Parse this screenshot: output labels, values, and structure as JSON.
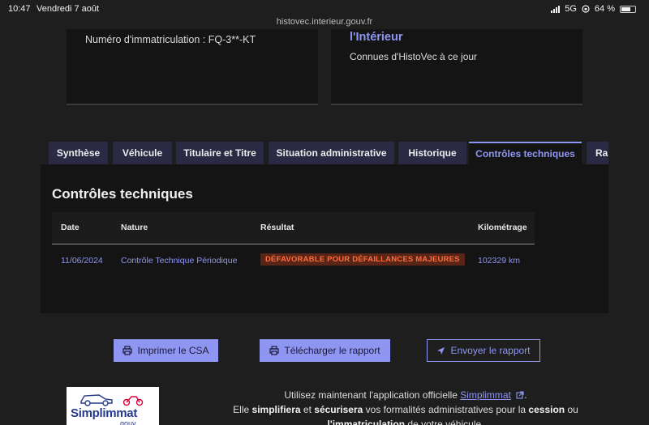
{
  "status_bar": {
    "time": "10:47",
    "date": "Vendredi 7 août",
    "network": "5G",
    "battery": "64 %",
    "battery_level": 0.64
  },
  "browser": {
    "url": "histovec.interieur.gouv.fr"
  },
  "cards": {
    "registration": "Numéro d'immatriculation : FQ-3**-KT",
    "source_title": "l'Intérieur",
    "source_subtitle": "Connues d'HistoVec à ce jour"
  },
  "tabs": [
    {
      "label": "Synthèse",
      "active": false
    },
    {
      "label": "Véhicule",
      "active": false
    },
    {
      "label": "Titulaire et Titre",
      "active": false
    },
    {
      "label": "Situation administrative",
      "active": false
    },
    {
      "label": "Historique",
      "active": false
    },
    {
      "label": "Contrôles techniques",
      "active": true
    },
    {
      "label": "Rap",
      "active": false
    }
  ],
  "panel": {
    "title": "Contrôles techniques",
    "table": {
      "headers": {
        "date": "Date",
        "nature": "Nature",
        "result": "Résultat",
        "mileage": "Kilométrage"
      },
      "rows": [
        {
          "date": "11/06/2024",
          "nature": "Contrôle Technique Périodique",
          "result": "DÉFAVORABLE POUR DÉFAILLANCES MAJEURES",
          "mileage": "102329 km"
        }
      ]
    }
  },
  "actions": {
    "print_label": "Imprimer le CSA",
    "download_label": "Télécharger le rapport",
    "send_label": "Envoyer le rapport"
  },
  "promo": {
    "logo_text": "Simplimmat",
    "logo_sub": "gouv",
    "line1_prefix": "Utilisez maintenant l'application officielle",
    "line1_link": "Simplimmat",
    "line1_suffix": ".",
    "line2_a": "Elle",
    "line2_b": "simplifiera",
    "line2_c": "et",
    "line2_d": "sécurisera",
    "line2_e": "vos formalités administratives pour la",
    "line2_f": "cession",
    "line2_g": "ou",
    "line3_a": "l'immatriculation",
    "line3_b": "de votre véhicule."
  },
  "colors": {
    "accent": "#8f96f2",
    "background": "#1e1e1e",
    "panel": "#141414",
    "tab_inactive": "#2a2a44",
    "danger_text": "#ff6d3a",
    "danger_bg": "#5a2417"
  }
}
